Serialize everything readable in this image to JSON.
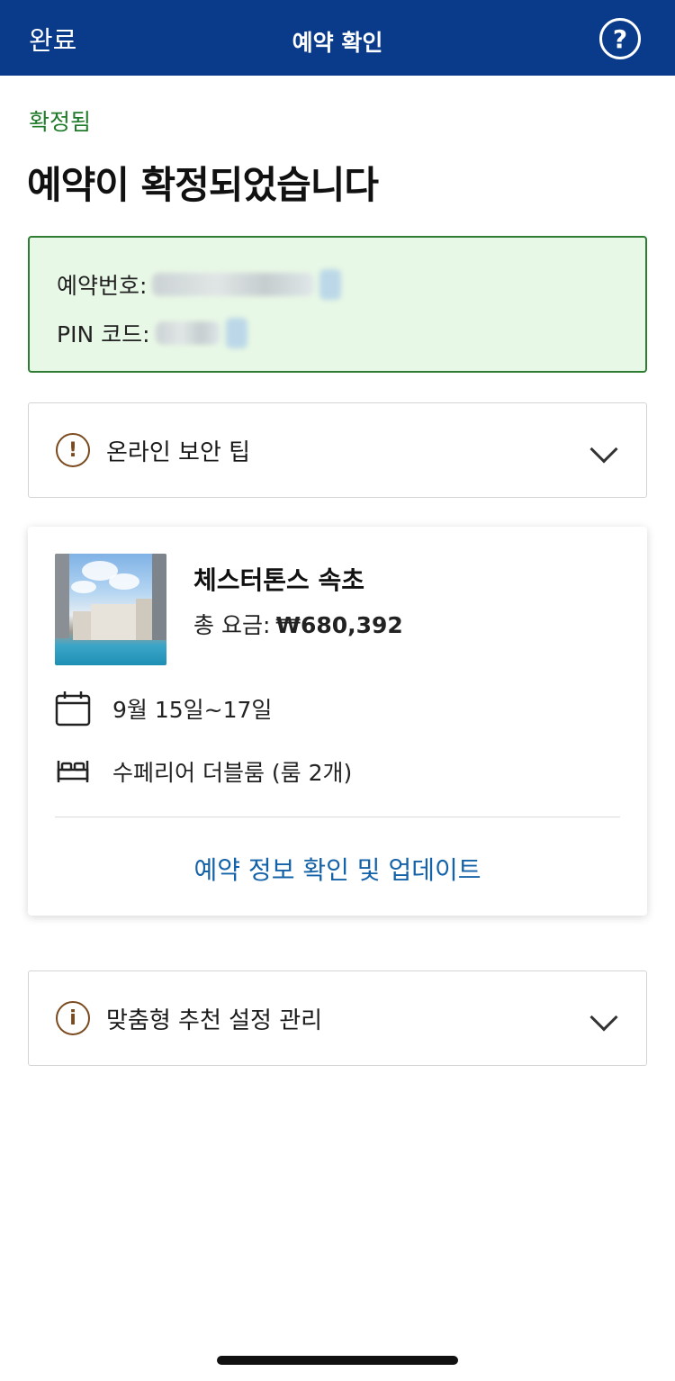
{
  "header": {
    "done_label": "완료",
    "title": "예약 확인",
    "help_label": "?"
  },
  "status": "확정됨",
  "heading": "예약이 확정되었습니다",
  "confirmation": {
    "booking_number_label": "예약번호:",
    "pin_label": "PIN 코드:"
  },
  "security_tips": {
    "label": "온라인 보안 팁",
    "icon_glyph": "!"
  },
  "hotel": {
    "name": "체스터톤스 속초",
    "total_label": "총 요금:",
    "total_price": "₩680,392",
    "dates": "9월 15일~17일",
    "room": "수페리어 더블룸 (룸 2개)",
    "manage_link": "예약 정보 확인 및 업데이트"
  },
  "preferences": {
    "label": "맞춤형 추천 설정 관리",
    "icon_glyph": "i"
  },
  "colors": {
    "header_bg": "#0a3a8a",
    "confirmed_green": "#1f7a2a",
    "info_box_bg": "#e8f8e6",
    "link_blue": "#1462a8",
    "icon_brown": "#7a4a1e"
  }
}
